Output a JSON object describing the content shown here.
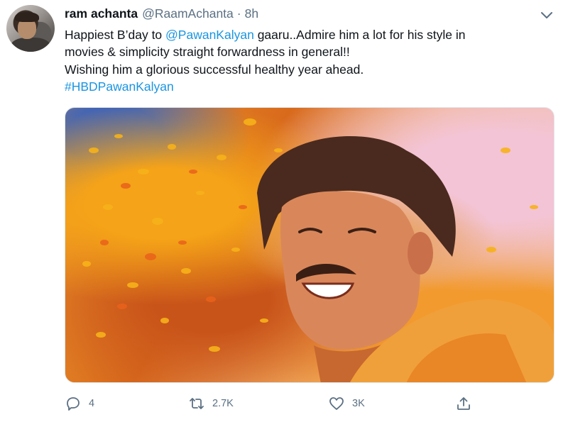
{
  "tweet": {
    "author_name": "ram achanta",
    "handle": "@RaamAchanta",
    "separator": "·",
    "time": "8h",
    "text": {
      "line1_prefix": "Happiest B’day to ",
      "line1_mention": "@PawanKalyan",
      "line1_suffix": " gaaru..Admire him a lot for his style in",
      "line2": "movies & simplicity straight forwardness in general!!",
      "line3": "Wishing him a glorious successful healthy year ahead.",
      "hashtag": "#HBDPawanKalyan"
    },
    "actions": {
      "reply_count": "4",
      "retweet_count": "2.7K",
      "like_count": "3K"
    }
  },
  "icons": {
    "menu": "chevron-down-icon",
    "reply": "reply-icon",
    "retweet": "retweet-icon",
    "like": "heart-icon",
    "share": "share-icon"
  },
  "colors": {
    "link": "#1b95e0",
    "muted": "#5b7083",
    "text": "#0f1419"
  }
}
